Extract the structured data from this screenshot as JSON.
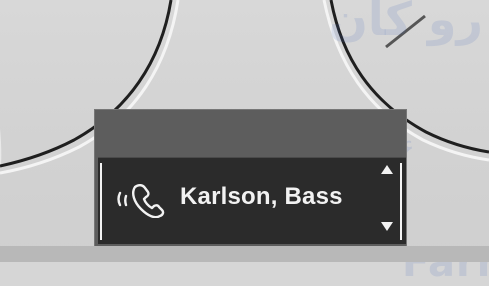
{
  "display": {
    "contact_name": "Karlson, Bass"
  },
  "icons": {
    "phone": "phone-handset-icon",
    "scroll_up": "up-arrow-icon",
    "scroll_down": "down-arrow-icon"
  },
  "colors": {
    "display_background": "#2b2b2b",
    "display_text": "#f2f2f2",
    "panel_background": "#d6d6d6",
    "bezel_line": "#4a4a4a"
  }
}
